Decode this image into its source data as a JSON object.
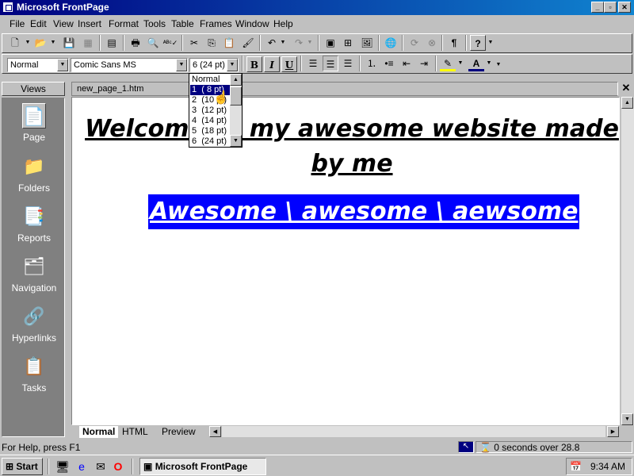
{
  "window": {
    "title": "Microsoft FrontPage"
  },
  "menu": [
    "File",
    "Edit",
    "View",
    "Insert",
    "Format",
    "Tools",
    "Table",
    "Frames",
    "Window",
    "Help"
  ],
  "format_toolbar": {
    "style": "Normal",
    "font": "Comic Sans MS",
    "size": "6  (24 pt)",
    "bold": "B",
    "italic": "I",
    "underline": "U"
  },
  "font_size_options": [
    "Normal",
    "1  ( 8 pt)",
    "2  (10 pt)",
    "3  (12 pt)",
    "4  (14 pt)",
    "5  (18 pt)",
    "6  (24 pt)"
  ],
  "views": {
    "header": "Views",
    "items": [
      "Page",
      "Folders",
      "Reports",
      "Navigation",
      "Hyperlinks",
      "Tasks"
    ]
  },
  "document": {
    "tab": "new_page_1.htm",
    "heading": "Welcome to my awesome website made by me",
    "banner": "Awesome \\ awesome \\ aewsome",
    "view_tabs": [
      "Normal",
      "HTML",
      "Preview"
    ]
  },
  "status": {
    "help": "For Help, press F1",
    "timing": "0 seconds over 28.8"
  },
  "taskbar": {
    "start": "Start",
    "task": "Microsoft FrontPage",
    "clock": "9:34 AM"
  },
  "colors": {
    "titlebar": "#000080",
    "banner_bg": "#0000ff",
    "panel": "#808080"
  }
}
